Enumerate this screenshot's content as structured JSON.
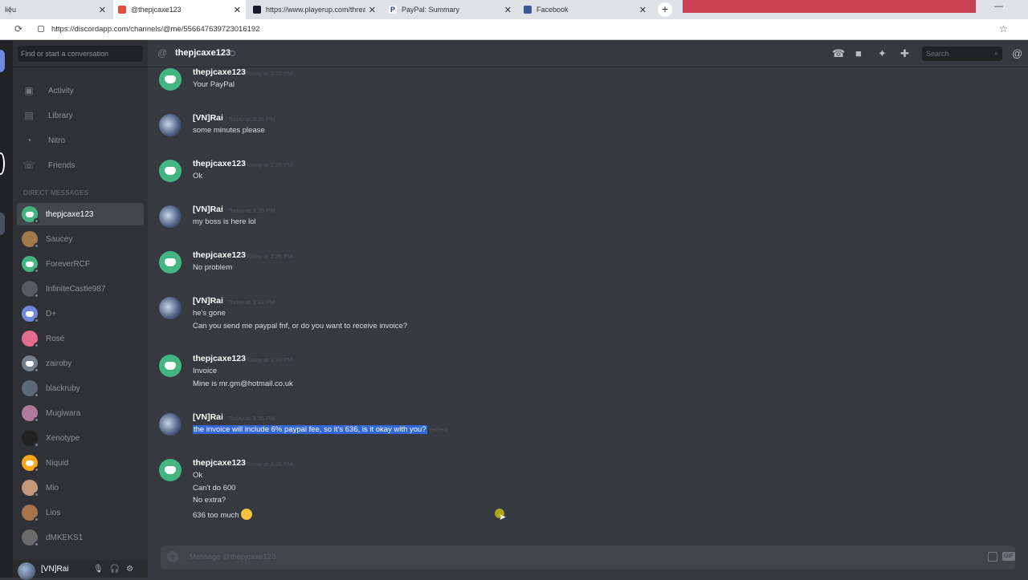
{
  "browser": {
    "tabs": [
      {
        "label": "liệu",
        "active": false
      },
      {
        "label": "@thepjcaxe123",
        "active": true
      },
      {
        "label": "https://www.playerup.com/threa",
        "active": false
      },
      {
        "label": "PayPal: Summary",
        "active": false
      },
      {
        "label": "Facebook",
        "active": false
      }
    ],
    "new_tab": "+",
    "url": "https://discordapp.com/channels/@me/556647639723016192"
  },
  "sidebar": {
    "search_placeholder": "Find or start a conversation",
    "nav": [
      {
        "label": "Activity",
        "icon": "gamepad-icon"
      },
      {
        "label": "Library",
        "icon": "library-icon"
      },
      {
        "label": "Nitro",
        "icon": "nitro-icon"
      },
      {
        "label": "Friends",
        "icon": "friends-icon"
      }
    ],
    "dm_header": "DIRECT MESSAGES",
    "dms": [
      {
        "name": "thepjcaxe123",
        "color": "#43b581",
        "selected": true
      },
      {
        "name": "Saucey",
        "color": "#a07a4a"
      },
      {
        "name": "ForeverRCF",
        "color": "#43b581"
      },
      {
        "name": "InfiniteCastle987",
        "color": "#555a63"
      },
      {
        "name": "D+",
        "color": "#7289da"
      },
      {
        "name": "Rosé",
        "color": "#e06e8c"
      },
      {
        "name": "zairoby",
        "color": "#747f8d"
      },
      {
        "name": "blackruby",
        "color": "#5a6a7a"
      },
      {
        "name": "Mugiwara",
        "color": "#b07a9a"
      },
      {
        "name": "Xenotype",
        "color": "#222222"
      },
      {
        "name": "Niquid",
        "color": "#faa61a"
      },
      {
        "name": "Mio",
        "color": "#c49a7a"
      },
      {
        "name": "Lios",
        "color": "#a8744a"
      },
      {
        "name": "dMKEKS1",
        "color": "#6a6a6a"
      }
    ],
    "user": {
      "name": "[VN]Rai"
    }
  },
  "chat": {
    "at_symbol": "@",
    "channel_name": "thepjcaxe123",
    "search_placeholder": "Search",
    "messages": [
      {
        "author": "thepjcaxe123",
        "avatar": "discord",
        "time": "Today at 3:26 PM",
        "lines": [
          "Your PayPal"
        ]
      },
      {
        "author": "[VN]Rai",
        "avatar": "rai",
        "time": "Today at 3:26 PM",
        "lines": [
          "some minutes please"
        ]
      },
      {
        "author": "thepjcaxe123",
        "avatar": "discord",
        "time": "Today at 3:26 PM",
        "lines": [
          "Ok"
        ]
      },
      {
        "author": "[VN]Rai",
        "avatar": "rai",
        "time": "Today at 3:26 PM",
        "lines": [
          "my boss is here lol"
        ]
      },
      {
        "author": "thepjcaxe123",
        "avatar": "discord",
        "time": "Today at 3:26 PM",
        "lines": [
          "No problem"
        ]
      },
      {
        "author": "[VN]Rai",
        "avatar": "rai",
        "time": "Today at 3:32 PM",
        "lines": [
          "he's gone",
          "Can you send me paypal fnf, or do you want to receive invoice?"
        ]
      },
      {
        "author": "thepjcaxe123",
        "avatar": "discord",
        "time": "Today at 3:33 PM",
        "lines": [
          "Invoice",
          "Mine is mr.gm@hotmail.co.uk"
        ]
      },
      {
        "author": "[VN]Rai",
        "avatar": "rai",
        "time": "Today at 3:35 PM",
        "lines": [
          "the invoice will include 6% paypal fee, so it's 636, is it okay with you?"
        ],
        "edited": "(edited)",
        "highlight": true
      },
      {
        "author": "thepjcaxe123",
        "avatar": "discord",
        "time": "Today at 3:35 PM",
        "lines": [
          "Ok",
          "Can't do 600",
          "No extra?",
          "636 too much"
        ]
      }
    ],
    "composer_placeholder": "Message @thepjcaxe123"
  }
}
